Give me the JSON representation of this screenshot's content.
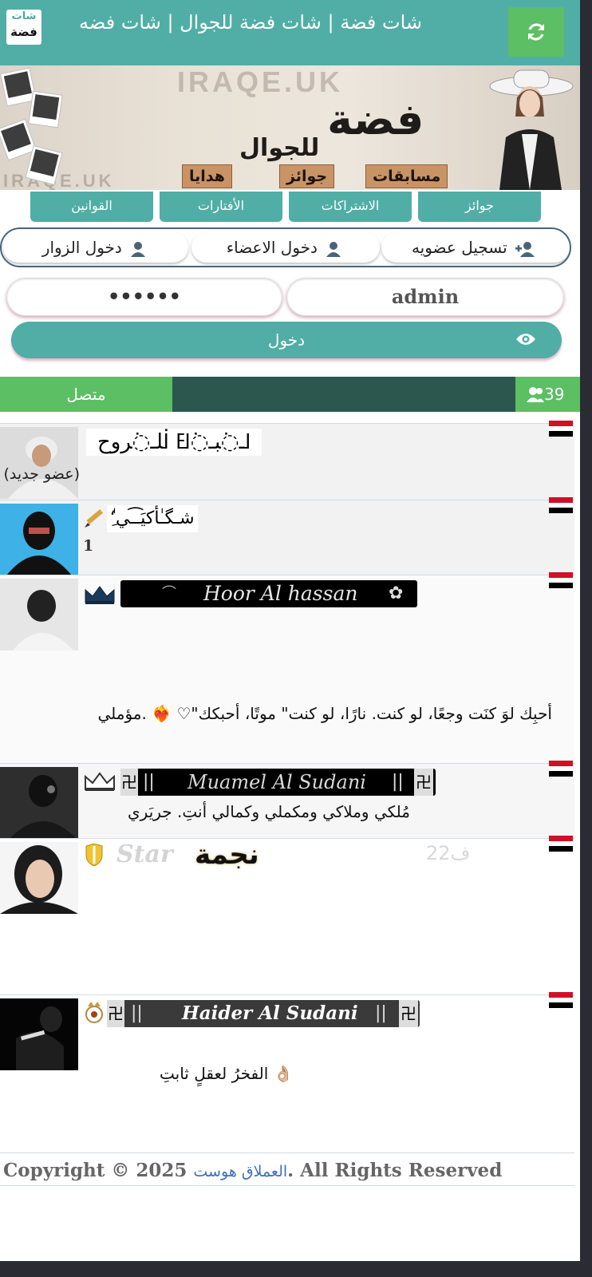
{
  "header": {
    "title": "شات فضة | شات فضة للجوال | شات فضه",
    "logo_top": "شات",
    "logo_bottom": "فضة",
    "refresh_icon": "refresh-icon",
    "accent": "#50aea6",
    "green": "#5cbf63"
  },
  "banner": {
    "watermark": "IRAQE.UK",
    "brand": "فضة",
    "brand_sub": "للجوال",
    "tags": [
      "مسابقات",
      "جوائز",
      "هدايا"
    ]
  },
  "nav": {
    "tabs": [
      "جوائز",
      "الاشتراكات",
      "الأفتارات",
      "القوانين"
    ]
  },
  "login": {
    "tabs": [
      "تسجيل عضويه",
      "دخول الاعضاء",
      "دخول الزوار"
    ],
    "username": "admin",
    "password": "••••••",
    "submit": "دخول"
  },
  "online": {
    "label": "متصل",
    "count": "39"
  },
  "users": [
    {
      "name": "ߊـ߭بـ߭ߊߓ ߊ߭لـ߭روح",
      "status": "(عضو جديد)",
      "badge": "none"
    },
    {
      "name": "ٰ‘ِشـگـٰأكيَـ͡ـي",
      "status": "1",
      "badge": "pen-icon"
    },
    {
      "name": "Hoor Al hassan",
      "status": "أحبِك لوَ كنَت وجعًا، لو كنت. نارًا، لو كنت\" موتًا، أحبكك\"♡ ❤️‍🔥 .مؤملي",
      "badge": "crown-icon"
    },
    {
      "name": "Muamel Al Sudani",
      "status": "مُلكي وملاكي ومكملي وكمالي أنتِ. جريَري",
      "badge": "crown-icon"
    },
    {
      "name": "نجمة",
      "name_deco": "Star",
      "name_tag": "ف22",
      "status": "",
      "badge": "shield-icon"
    },
    {
      "name": "Haider Al Sudani",
      "status": "الفخرُ لعقلٍ ثابتِ",
      "badge": "emblem-icon"
    }
  ],
  "footer": {
    "prefix": "Copyright © 2025",
    "link": "العملاق هوست",
    "suffix": ". All Rights Reserved"
  }
}
